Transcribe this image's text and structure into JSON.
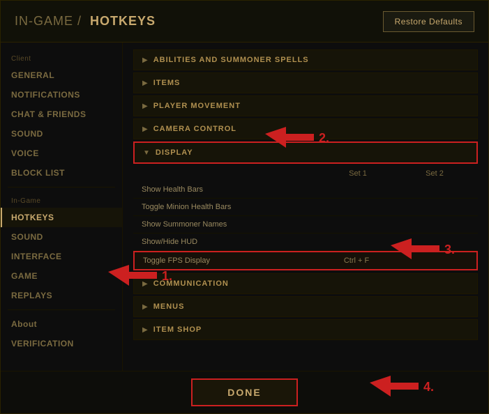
{
  "header": {
    "breadcrumb_prefix": "IN-GAME /",
    "breadcrumb_current": "HOTKEYS",
    "restore_button": "Restore Defaults"
  },
  "sidebar": {
    "client_label": "Client",
    "ingame_label": "In-Game",
    "about_label": "About",
    "client_items": [
      {
        "id": "general",
        "label": "GENERAL",
        "active": false
      },
      {
        "id": "notifications",
        "label": "NOTIFICATIONS",
        "active": false
      },
      {
        "id": "chat-friends",
        "label": "CHAT & FRIENDS",
        "active": false
      },
      {
        "id": "sound",
        "label": "SOUND",
        "active": false
      },
      {
        "id": "voice",
        "label": "VOICE",
        "active": false
      },
      {
        "id": "blocklist",
        "label": "BLOCK LIST",
        "active": false
      }
    ],
    "ingame_items": [
      {
        "id": "hotkeys",
        "label": "HOTKEYS",
        "active": true
      },
      {
        "id": "sound",
        "label": "SOUND",
        "active": false
      },
      {
        "id": "interface",
        "label": "INTERFACE",
        "active": false
      },
      {
        "id": "game",
        "label": "GAME",
        "active": false
      },
      {
        "id": "replays",
        "label": "REPLAYS",
        "active": false
      }
    ],
    "bottom_items": [
      {
        "id": "about",
        "label": "About"
      },
      {
        "id": "verification",
        "label": "VERIFICATION"
      }
    ]
  },
  "content": {
    "categories": [
      {
        "id": "abilities",
        "label": "ABILITIES AND SUMMONER SPELLS",
        "expanded": false
      },
      {
        "id": "items",
        "label": "ITEMS",
        "expanded": false
      },
      {
        "id": "player-movement",
        "label": "PLAYER MOVEMENT",
        "expanded": false
      },
      {
        "id": "camera-control",
        "label": "CAMERA CONTROL",
        "expanded": false
      },
      {
        "id": "display",
        "label": "DISPLAY",
        "expanded": true
      },
      {
        "id": "communication",
        "label": "COMMUNICATION",
        "expanded": false
      },
      {
        "id": "menus",
        "label": "MENUS",
        "expanded": false
      },
      {
        "id": "item-shop",
        "label": "ITEM SHOP",
        "expanded": false
      }
    ],
    "display_header": {
      "set1": "Set 1",
      "set2": "Set 2"
    },
    "display_hotkeys": [
      {
        "name": "Show Health Bars",
        "set1": "",
        "set2": ""
      },
      {
        "name": "Toggle Minion Health Bars",
        "set1": "",
        "set2": ""
      },
      {
        "name": "Show Summoner Names",
        "set1": "",
        "set2": ""
      },
      {
        "name": "Show/Hide HUD",
        "set1": "",
        "set2": ""
      },
      {
        "name": "Toggle FPS Display",
        "set1": "Ctrl + F",
        "set2": ""
      }
    ]
  },
  "footer": {
    "done_button": "DONE"
  },
  "annotations": [
    {
      "id": "1",
      "label": "1."
    },
    {
      "id": "2",
      "label": "2."
    },
    {
      "id": "3",
      "label": "3."
    },
    {
      "id": "4",
      "label": "4."
    }
  ]
}
